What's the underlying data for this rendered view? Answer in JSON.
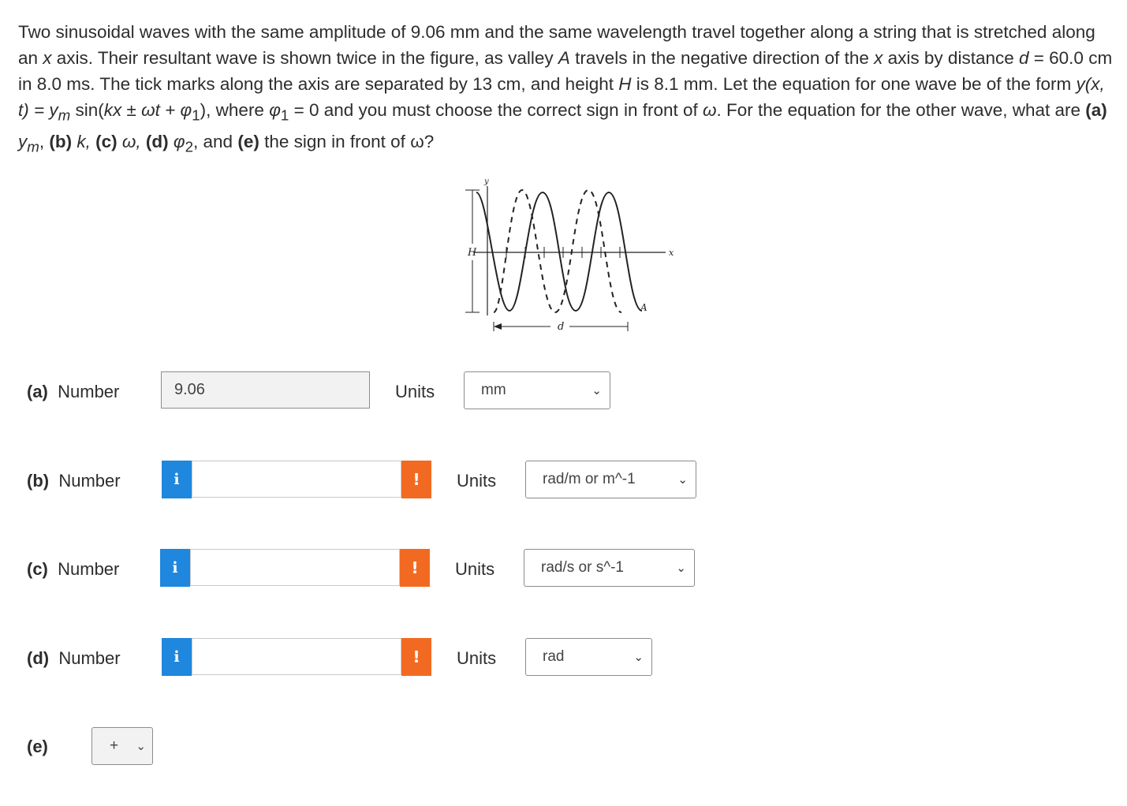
{
  "question": {
    "s1": "Two sinusoidal waves with the same amplitude of 9.06 mm and the same wavelength travel together along a string that is stretched along an ",
    "s2": "x",
    "s3": " axis. Their resultant wave is shown twice in the figure, as valley ",
    "s4": "A",
    "s5": " travels in the negative direction of the ",
    "s6": "x",
    "s7": " axis by distance ",
    "s8": "d",
    "s9": " = 60.0 cm in 8.0 ms. The tick marks along the axis are separated by 13 cm, and height ",
    "s10": "H",
    "s11": " is 8.1 mm. Let the equation for one wave be of the form ",
    "s12": "y(x, t) = y",
    "s13": "m",
    "s14": " sin(",
    "s15": "kx ± ωt + φ",
    "s16": "1",
    "s17": "), where ",
    "s18": "φ",
    "s19": "1",
    "s20": " = 0 and you must choose the correct sign in front of ",
    "s21": "ω",
    "s22": ". For the equation for the other wave, what are ",
    "s23": "(a)",
    "s24": " y",
    "s25": "m",
    "s26": ", ",
    "s27": "(b)",
    "s28": " k, ",
    "s29": "(c)",
    "s30": " ω, ",
    "s31": "(d)",
    "s32": " φ",
    "s33": "2",
    "s34": ", and ",
    "s35": "(e)",
    "s36": " the sign in front of ω?"
  },
  "figure": {
    "y_label": "y",
    "x_label": "x",
    "h_label": "H",
    "d_label": "d",
    "a_label": "A"
  },
  "rows": [
    {
      "letter": "(a)",
      "label": "Number",
      "value": "9.06",
      "units_label": "Units",
      "unit": "mm"
    },
    {
      "letter": "(b)",
      "label": "Number",
      "value": "",
      "units_label": "Units",
      "unit": "rad/m or m^-1"
    },
    {
      "letter": "(c)",
      "label": "Number",
      "value": "",
      "units_label": "Units",
      "unit": "rad/s or s^-1"
    },
    {
      "letter": "(d)",
      "label": "Number",
      "value": "",
      "units_label": "Units",
      "unit": "rad"
    }
  ],
  "row_e": {
    "letter": "(e)",
    "sign": "+"
  },
  "icons": {
    "info": "i",
    "warning": "!",
    "chevron": "⌄"
  },
  "colors": {
    "info": "#1f87dd",
    "warning": "#f26a21"
  }
}
